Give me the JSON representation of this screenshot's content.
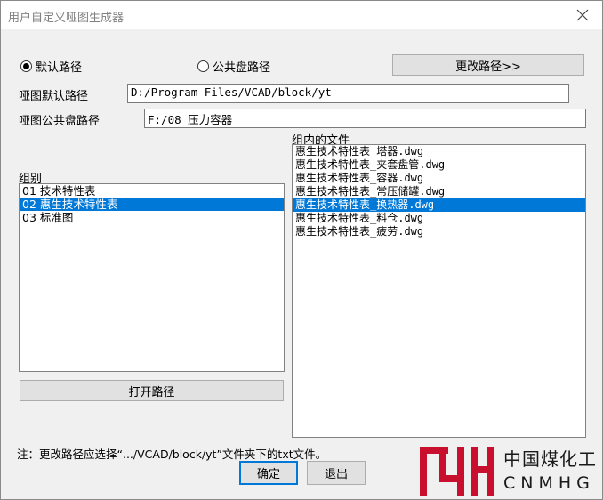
{
  "window": {
    "title": "用户自定义哑图生成器"
  },
  "path_mode": {
    "default_label": "默认路径",
    "public_label": "公共盘路径",
    "selected": "default"
  },
  "change_path_button": "更改路径>>",
  "default_path": {
    "label": "哑图默认路径",
    "value": "D:/Program Files/VCAD/block/yt"
  },
  "public_path": {
    "label": "哑图公共盘路径",
    "value": "F:/08 压力容器"
  },
  "groups": {
    "label": "组别",
    "items": [
      "01 技术特性表",
      "02 惠生技术特性表",
      "03 标准图"
    ],
    "selected_index": 1
  },
  "group_files": {
    "label": "组内的文件",
    "items": [
      "惠生技术特性表_塔器.dwg",
      "惠生技术特性表_夹套盘管.dwg",
      "惠生技术特性表_容器.dwg",
      "惠生技术特性表_常压储罐.dwg",
      "惠生技术特性表_换热器.dwg",
      "惠生技术特性表_料仓.dwg",
      "惠生技术特性表_疲劳.dwg"
    ],
    "selected_index": 4
  },
  "open_path_button": "打开路径",
  "note": "注：更改路径应选择“.../VCAD/block/yt”文件夹下的txt文件。",
  "ok_button": "确定",
  "exit_button": "退出",
  "watermark": {
    "cn": "中国煤化工",
    "en": "CNMHG",
    "color": "#c8102e"
  }
}
